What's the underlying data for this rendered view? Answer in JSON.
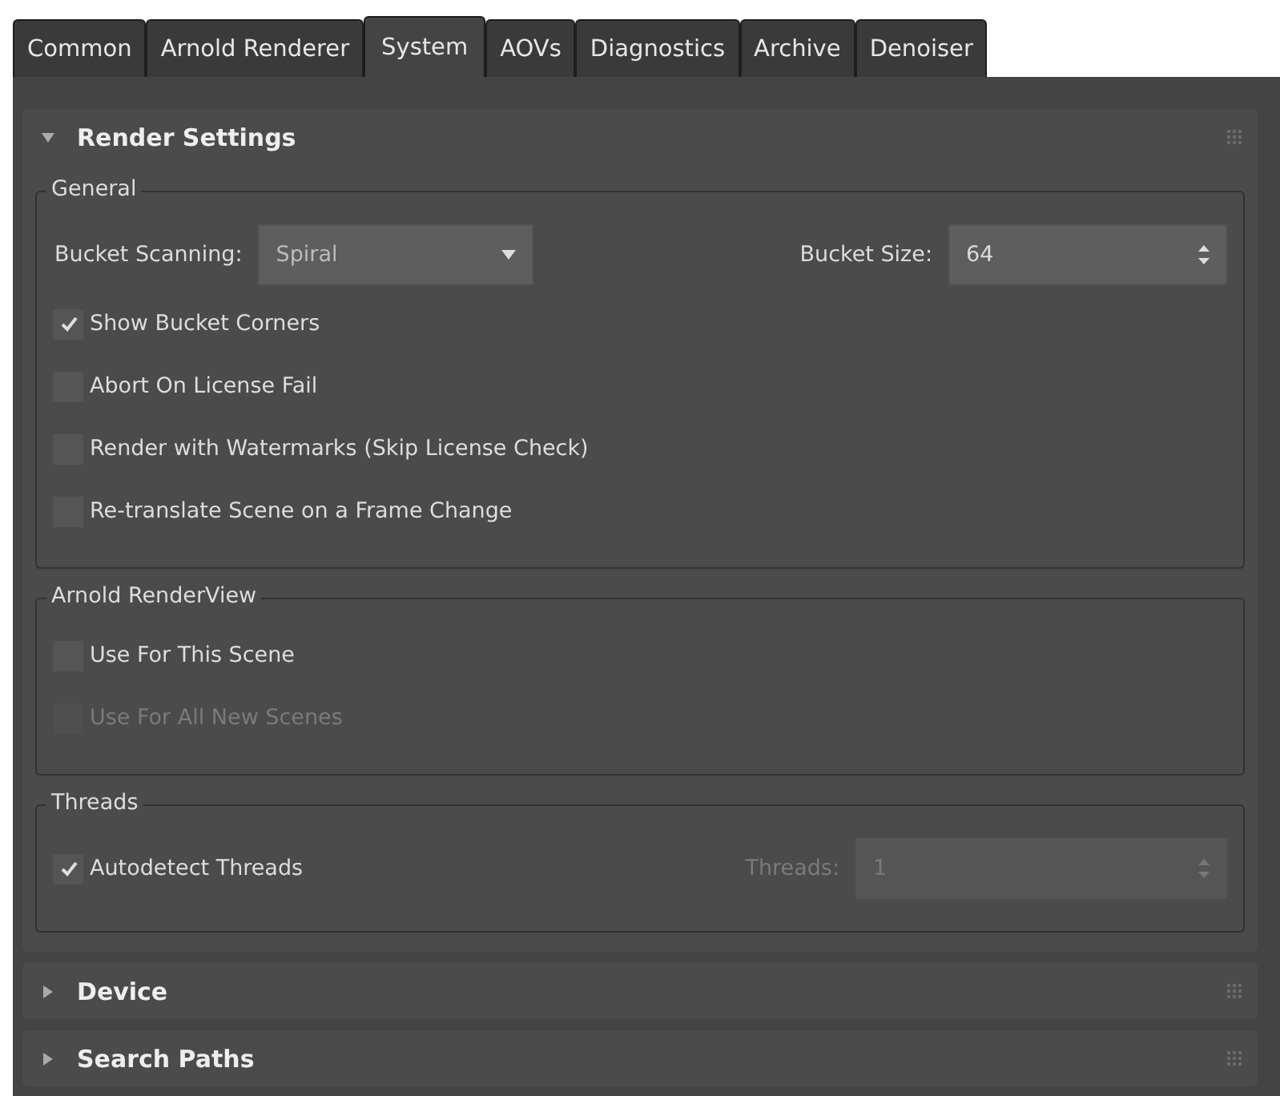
{
  "tabs": [
    {
      "label": "Common",
      "selected": false
    },
    {
      "label": "Arnold Renderer",
      "selected": false
    },
    {
      "label": "System",
      "selected": true
    },
    {
      "label": "AOVs",
      "selected": false
    },
    {
      "label": "Diagnostics",
      "selected": false
    },
    {
      "label": "Archive",
      "selected": false
    },
    {
      "label": "Denoiser",
      "selected": false
    }
  ],
  "rollouts": [
    {
      "title": "Render Settings",
      "expanded": true,
      "groups": [
        {
          "title": "General",
          "items": [
            {
              "kind": "fields",
              "fields": [
                {
                  "kind": "dropdown",
                  "label": "Bucket Scanning:",
                  "value": "Spiral",
                  "disabled": false
                },
                {
                  "kind": "spinner",
                  "label": "Bucket Size:",
                  "value": "64",
                  "disabled": false
                }
              ]
            },
            {
              "kind": "checkbox",
              "label": "Show Bucket Corners",
              "checked": true,
              "disabled": false
            },
            {
              "kind": "checkbox",
              "label": "Abort On License Fail",
              "checked": false,
              "disabled": false
            },
            {
              "kind": "checkbox",
              "label": "Render with Watermarks (Skip License Check)",
              "checked": false,
              "disabled": false
            },
            {
              "kind": "checkbox",
              "label": "Re-translate Scene on a Frame Change",
              "checked": false,
              "disabled": false
            }
          ]
        },
        {
          "title": "Arnold RenderView",
          "items": [
            {
              "kind": "checkbox",
              "label": "Use For This Scene",
              "checked": false,
              "disabled": false
            },
            {
              "kind": "checkbox",
              "label": "Use For All New Scenes",
              "checked": false,
              "disabled": true
            }
          ]
        },
        {
          "title": "Threads",
          "items": [
            {
              "kind": "checkfield",
              "label": "Autodetect Threads",
              "checked": true,
              "disabled": false,
              "field": {
                "label": "Threads:",
                "value": "1",
                "disabled": true
              }
            }
          ]
        }
      ]
    },
    {
      "title": "Device",
      "expanded": false
    },
    {
      "title": "Search Paths",
      "expanded": false
    }
  ]
}
